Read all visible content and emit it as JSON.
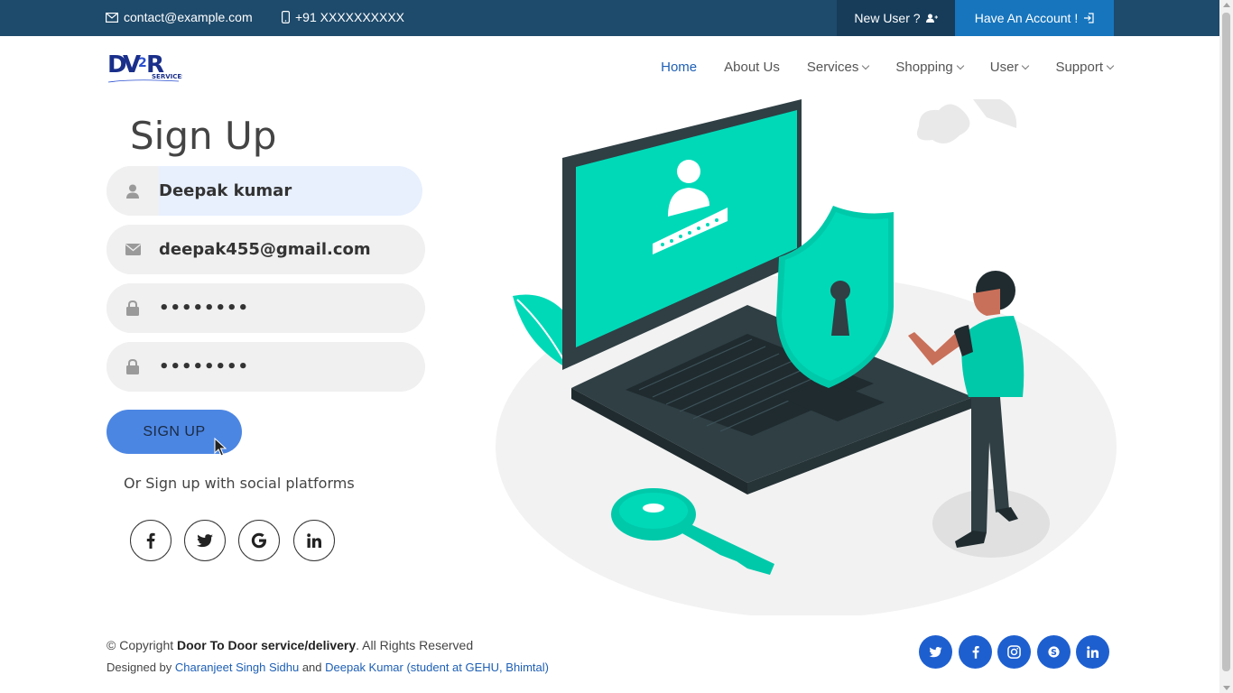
{
  "topbar": {
    "email": "contact@example.com",
    "phone": "+91 XXXXXXXXXX",
    "new_user": "New User ?",
    "have_account": "Have An Account !"
  },
  "nav": {
    "items": [
      {
        "label": "Home",
        "active": true
      },
      {
        "label": "About Us"
      },
      {
        "label": "Services",
        "dropdown": true
      },
      {
        "label": "Shopping",
        "dropdown": true
      },
      {
        "label": "User",
        "dropdown": true
      },
      {
        "label": "Support",
        "dropdown": true
      }
    ]
  },
  "form": {
    "title": "Sign Up",
    "name_value": "Deepak kumar",
    "email_value": "deepak455@gmail.com",
    "password_value": "••••••••",
    "confirm_value": "••••••••",
    "submit_label": "SIGN UP",
    "social_text": "Or Sign up with social platforms",
    "social_icons": [
      "facebook-icon",
      "twitter-icon",
      "google-icon",
      "linkedin-icon"
    ]
  },
  "footer": {
    "copy_prefix": "© Copyright ",
    "copy_brand": "Door To Door service/delivery",
    "copy_suffix": ". All Rights Reserved",
    "designed_prefix": "Designed by ",
    "designer1": "Charanjeet Singh Sidhu",
    "designed_and": " and ",
    "designer2": "Deepak Kumar (student at GEHU, Bhimtal)",
    "social_icons": [
      "twitter-icon",
      "facebook-icon",
      "instagram-icon",
      "skype-icon",
      "linkedin-icon"
    ]
  },
  "colors": {
    "topbar": "#1e4a6b",
    "accent": "#1675bd",
    "button": "#4c86e3",
    "illustration": "#00d9b8"
  }
}
